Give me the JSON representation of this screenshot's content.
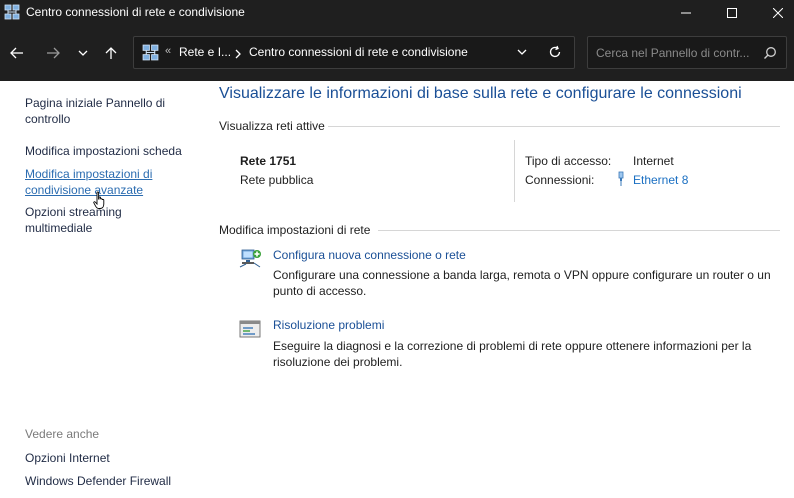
{
  "window": {
    "title": "Centro connessioni di rete e condivisione"
  },
  "address": {
    "overflow": "«",
    "crumb1": "Rete e I...",
    "crumb2": "Centro connessioni di rete e condivisione"
  },
  "search": {
    "placeholder": "Cerca nel Pannello di contr..."
  },
  "sidebar": {
    "items": [
      {
        "label": "Pagina iniziale Pannello di controllo"
      },
      {
        "label": "Modifica impostazioni scheda"
      },
      {
        "label": "Modifica impostazioni di condivisione avanzate"
      },
      {
        "label": "Opzioni streaming multimediale"
      }
    ],
    "see_also_label": "Vedere anche",
    "see_also": [
      {
        "label": "Opzioni Internet"
      },
      {
        "label": "Windows Defender Firewall"
      }
    ]
  },
  "main": {
    "title": "Visualizzare le informazioni di base sulla rete e configurare le connessioni",
    "active_section": "Visualizza reti attive",
    "network": {
      "name": "Rete 1751",
      "type": "Rete pubblica",
      "access_label": "Tipo di accesso:",
      "access_value": "Internet",
      "connections_label": "Connessioni:",
      "connections_value": "Ethernet 8"
    },
    "change_section": "Modifica impostazioni di rete",
    "tasks": [
      {
        "link": "Configura nuova connessione o rete",
        "desc": "Configurare una connessione a banda larga, remota o VPN oppure configurare un router o un punto di accesso."
      },
      {
        "link": "Risoluzione problemi",
        "desc": "Eseguire la diagnosi e la correzione di problemi di rete oppure ottenere informazioni per la risoluzione dei problemi."
      }
    ]
  },
  "colors": {
    "titlebar_bg": "#1f1f1f",
    "link": "#1a4f96",
    "accent_link": "#1a6fc2"
  }
}
